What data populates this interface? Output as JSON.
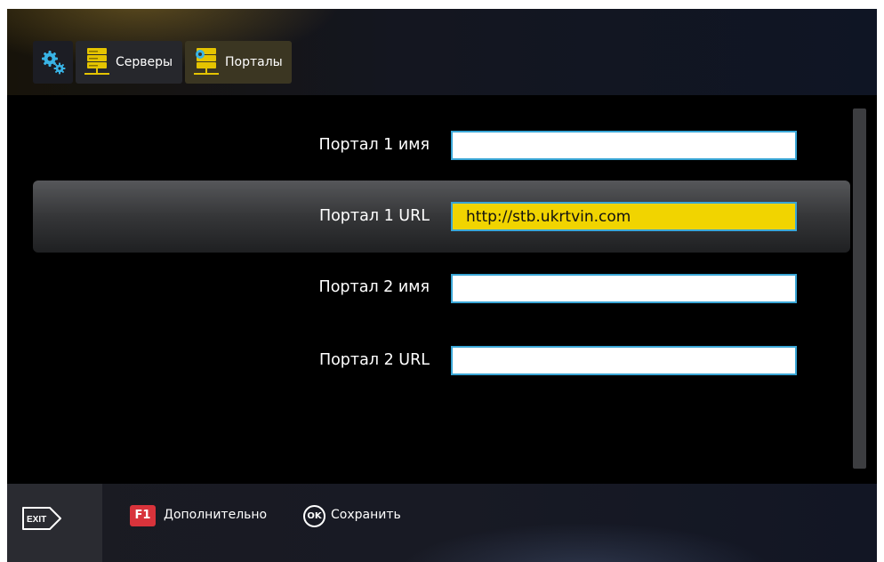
{
  "tabs": {
    "settings_icon": "gears-icon",
    "servers": {
      "label": "Серверы",
      "icon": "server-stack-icon"
    },
    "portals": {
      "label": "Порталы",
      "icon": "server-stack-gear-icon"
    }
  },
  "form": {
    "fields": [
      {
        "label": "Портал 1 имя",
        "value": ""
      },
      {
        "label": "Портал 1 URL",
        "value": "http://stb.ukrtvin.com",
        "focused": true
      },
      {
        "label": "Портал 2 имя",
        "value": ""
      },
      {
        "label": "Портал 2 URL",
        "value": ""
      }
    ]
  },
  "footer": {
    "exit_label": "EXIT",
    "f1_key": "F1",
    "f1_label": "Дополнительно",
    "ok_key": "OK",
    "ok_label": "Сохранить"
  },
  "colors": {
    "focus_field": "#f1d400",
    "field_border": "#3aa6d6",
    "f1_red": "#d8333b"
  }
}
